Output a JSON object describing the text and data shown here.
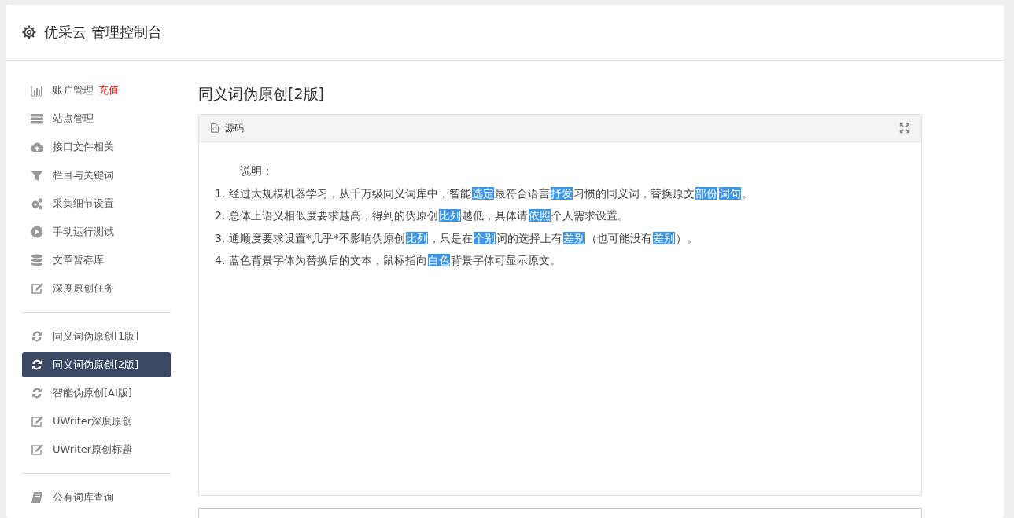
{
  "header": {
    "title": "优采云 管理控制台"
  },
  "sidebar": {
    "groups": [
      {
        "items": [
          {
            "kind": "chart",
            "label": "账户管理",
            "badge": "充值",
            "selected": false
          },
          {
            "kind": "server",
            "label": "站点管理",
            "selected": false
          },
          {
            "kind": "cloud",
            "label": "接口文件相关",
            "selected": false
          },
          {
            "kind": "filter",
            "label": "栏目与关键词",
            "selected": false
          },
          {
            "kind": "gears",
            "label": "采集细节设置",
            "selected": false
          },
          {
            "kind": "play",
            "label": "手动运行测试",
            "selected": false
          },
          {
            "kind": "database",
            "label": "文章暂存库",
            "selected": false
          },
          {
            "kind": "edit",
            "label": "深度原创任务",
            "selected": false
          }
        ]
      },
      {
        "items": [
          {
            "kind": "refresh",
            "label": "同义词伪原创[1版]",
            "selected": false
          },
          {
            "kind": "refresh",
            "label": "同义词伪原创[2版]",
            "selected": true
          },
          {
            "kind": "refresh",
            "label": "智能伪原创[AI版]",
            "selected": false
          },
          {
            "kind": "edit",
            "label": "UWriter深度原创",
            "selected": false
          },
          {
            "kind": "edit",
            "label": "UWriter原创标题",
            "selected": false
          }
        ]
      },
      {
        "items": [
          {
            "kind": "book",
            "label": "公有词库查询",
            "selected": false
          }
        ]
      }
    ]
  },
  "content": {
    "title": "同义词伪原创[2版]",
    "panel": {
      "title": "源码",
      "lines": [
        {
          "kind": "heading",
          "segments": [
            {
              "text": "说明：",
              "highlighted": false
            }
          ]
        },
        {
          "kind": "item",
          "segments": [
            {
              "text": "1. 经过大规模机器学习，从千万级同义词库中，智能",
              "highlighted": false
            },
            {
              "text": "选定",
              "highlighted": true
            },
            {
              "text": "最符合语言",
              "highlighted": false
            },
            {
              "text": "抒发",
              "highlighted": true
            },
            {
              "text": "习惯的同义词，替换原文",
              "highlighted": false
            },
            {
              "text": "部份",
              "highlighted": true
            },
            {
              "text": "词句",
              "highlighted": true
            },
            {
              "text": "。",
              "highlighted": false
            }
          ]
        },
        {
          "kind": "item",
          "segments": [
            {
              "text": "2. 总体上语义相似度要求越高，得到的伪原创",
              "highlighted": false
            },
            {
              "text": "比列",
              "highlighted": true
            },
            {
              "text": "越低，具体请",
              "highlighted": false
            },
            {
              "text": "依照",
              "highlighted": true
            },
            {
              "text": "个人需求设置。",
              "highlighted": false
            }
          ]
        },
        {
          "kind": "item",
          "segments": [
            {
              "text": "3. 通顺度要求设置*几乎*不影响伪原创",
              "highlighted": false
            },
            {
              "text": "比列",
              "highlighted": true
            },
            {
              "text": "，只是在",
              "highlighted": false
            },
            {
              "text": "个别",
              "highlighted": true
            },
            {
              "text": "词的选择上有",
              "highlighted": false
            },
            {
              "text": "差别",
              "highlighted": true
            },
            {
              "text": "（也可能没有",
              "highlighted": false
            },
            {
              "text": "差别",
              "highlighted": true
            },
            {
              "text": "）。",
              "highlighted": false
            }
          ]
        },
        {
          "kind": "item",
          "segments": [
            {
              "text": "4. 蓝色背景字体为替换后的文本，鼠标指向",
              "highlighted": false
            },
            {
              "text": "白色",
              "highlighted": true
            },
            {
              "text": "背景字体可显示原文。",
              "highlighted": false
            }
          ]
        }
      ]
    }
  }
}
